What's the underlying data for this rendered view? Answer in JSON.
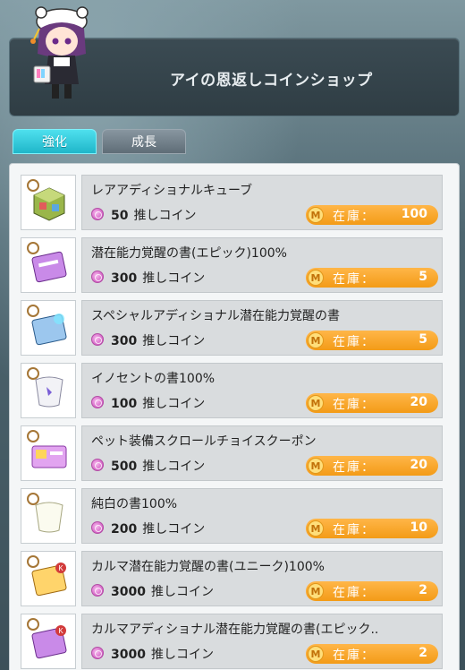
{
  "shop": {
    "title": "アイの恩返しコインショップ"
  },
  "tabs": [
    {
      "label": "強化",
      "active": true
    },
    {
      "label": "成長",
      "active": false
    }
  ],
  "labels": {
    "currency": "推しコイン",
    "stock": "在庫："
  },
  "colors": {
    "active_tab": "#1fb6c9",
    "stock_badge": "#f39b17",
    "coin": "#d360c4"
  },
  "items": [
    {
      "name": "レアアディショナルキューブ",
      "price": "50",
      "stock": "100",
      "icon": "cube-icon"
    },
    {
      "name": "潜在能力覚醒の書(エピック)100%",
      "price": "300",
      "stock": "5",
      "icon": "epic-scroll-icon"
    },
    {
      "name": "スペシャルアディショナル潜在能力覚醒の書",
      "price": "300",
      "stock": "5",
      "icon": "special-scroll-icon"
    },
    {
      "name": "イノセントの書100%",
      "price": "100",
      "stock": "20",
      "icon": "innocent-scroll-icon"
    },
    {
      "name": "ペット装備スクロールチョイスクーポン",
      "price": "500",
      "stock": "20",
      "icon": "pet-coupon-icon"
    },
    {
      "name": "純白の書100%",
      "price": "200",
      "stock": "10",
      "icon": "white-scroll-icon"
    },
    {
      "name": "カルマ潜在能力覚醒の書(ユニーク)100%",
      "price": "3000",
      "stock": "2",
      "icon": "karma-unique-scroll-icon"
    },
    {
      "name": "カルマアディショナル潜在能力覚醒の書(エピック..",
      "price": "3000",
      "stock": "2",
      "icon": "karma-epic-scroll-icon"
    }
  ]
}
